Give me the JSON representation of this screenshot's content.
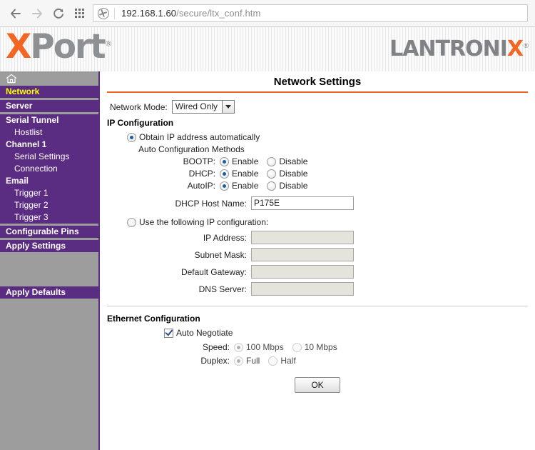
{
  "browser": {
    "back_icon": "back-arrow-icon",
    "forward_icon": "forward-arrow-icon",
    "reload_icon": "reload-icon",
    "apps_icon": "apps-grid-icon",
    "page_info_icon": "page-info-globe-icon",
    "url_host": "192.168.1.60",
    "url_path": "/secure/ltx_conf.htm"
  },
  "header": {
    "product_x": "X",
    "product_name": "Port",
    "registered_mark": "®",
    "brand_prefix": "LANTRONI",
    "brand_x": "X",
    "accent_color": "#f26522",
    "gray_color": "#8e9194"
  },
  "sidebar": {
    "home_icon": "home-icon",
    "active_color": "#ffff00",
    "background_color": "#5b2d82",
    "items": [
      {
        "label": "Network",
        "level": "top",
        "active": true
      },
      {
        "label": "Server",
        "level": "top",
        "active": false
      },
      {
        "label": "Serial Tunnel",
        "level": "top",
        "active": false
      },
      {
        "label": "Hostlist",
        "level": "sub",
        "active": false
      },
      {
        "label": "Channel 1",
        "level": "top",
        "active": false
      },
      {
        "label": "Serial Settings",
        "level": "sub",
        "active": false
      },
      {
        "label": "Connection",
        "level": "sub",
        "active": false
      },
      {
        "label": "Email",
        "level": "top",
        "active": false
      },
      {
        "label": "Trigger 1",
        "level": "sub",
        "active": false
      },
      {
        "label": "Trigger 2",
        "level": "sub",
        "active": false
      },
      {
        "label": "Trigger 3",
        "level": "sub",
        "active": false
      },
      {
        "label": "Configurable Pins",
        "level": "top",
        "active": false
      },
      {
        "label": "Apply Settings",
        "level": "top",
        "active": false
      },
      {
        "label": "Apply Defaults",
        "level": "top",
        "active": false
      }
    ]
  },
  "main": {
    "title": "Network Settings",
    "network_mode_label": "Network Mode:",
    "network_mode_value": "Wired Only",
    "ip_configuration_heading": "IP Configuration",
    "obtain_auto_label": "Obtain IP address automatically",
    "obtain_auto_selected": true,
    "auto_config_methods_label": "Auto Configuration Methods",
    "auto_methods": [
      {
        "label": "BOOTP:",
        "enable_label": "Enable",
        "disable_label": "Disable",
        "selected": "Enable"
      },
      {
        "label": "DHCP:",
        "enable_label": "Enable",
        "disable_label": "Disable",
        "selected": "Enable"
      },
      {
        "label": "AutoIP:",
        "enable_label": "Enable",
        "disable_label": "Disable",
        "selected": "Enable"
      }
    ],
    "dhcp_host_name_label": "DHCP Host Name:",
    "dhcp_host_name_value": "P175E",
    "use_static_label": "Use the following IP configuration:",
    "use_static_selected": false,
    "static_fields": [
      {
        "label": "IP Address:",
        "value": ""
      },
      {
        "label": "Subnet Mask:",
        "value": ""
      },
      {
        "label": "Default Gateway:",
        "value": ""
      },
      {
        "label": "DNS Server:",
        "value": ""
      }
    ],
    "ethernet_heading": "Ethernet Configuration",
    "auto_negotiate_label": "Auto Negotiate",
    "auto_negotiate_checked": true,
    "speed_label": "Speed:",
    "speed_option_1": "100 Mbps",
    "speed_option_2": "10 Mbps",
    "speed_selected": "100 Mbps",
    "duplex_label": "Duplex:",
    "duplex_option_1": "Full",
    "duplex_option_2": "Half",
    "duplex_selected": "Full",
    "ok_label": "OK"
  }
}
